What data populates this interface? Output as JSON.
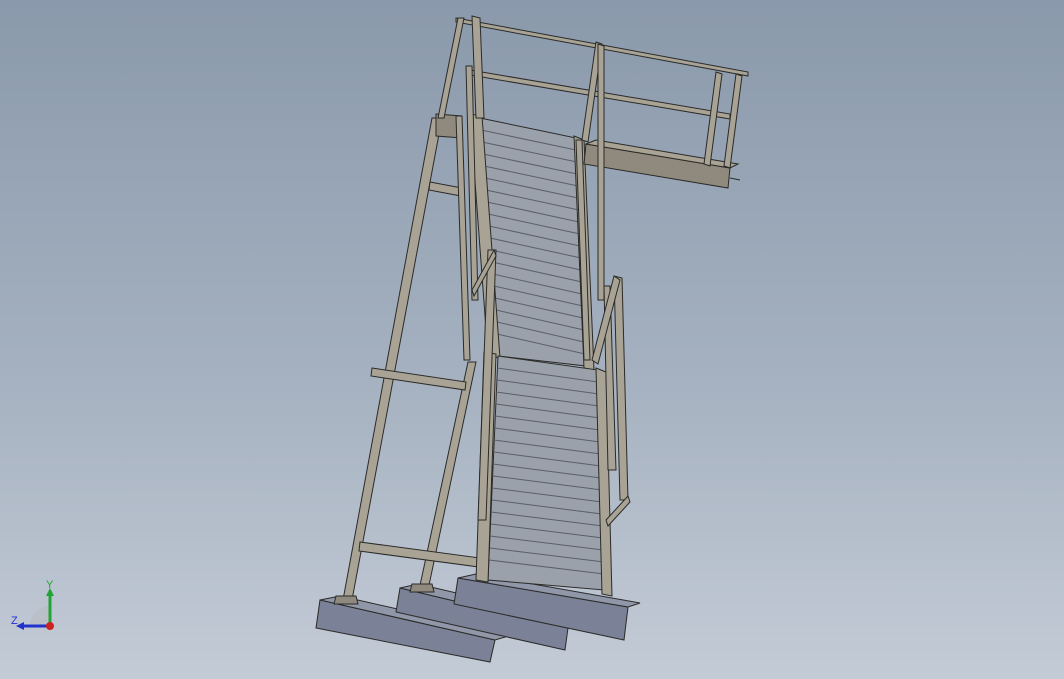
{
  "viewport": {
    "background_top": "#8a99ab",
    "background_bottom": "#c3cbd6"
  },
  "model": {
    "frame_color": "#a8a394",
    "frame_edge_color": "#2a2a28",
    "step_color": "#9ba1ab",
    "base_block_color": "#7b8196"
  },
  "triad": {
    "y_label": "Y",
    "z_label": "Z",
    "y_color": "#22a336",
    "z_color": "#2233cc",
    "x_color": "#cc2222"
  }
}
